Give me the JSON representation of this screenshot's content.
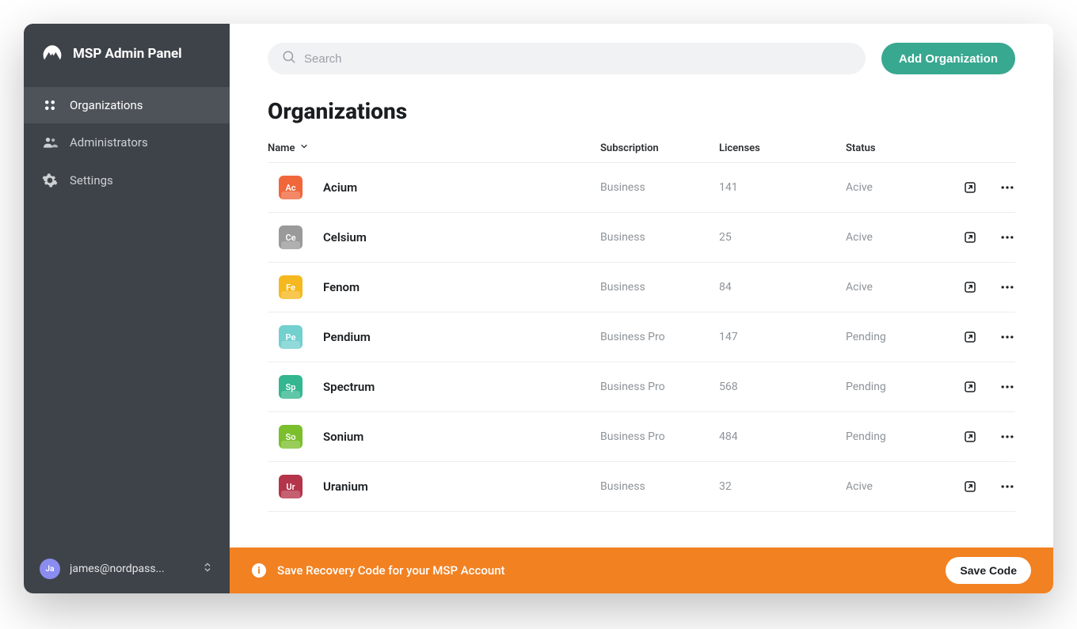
{
  "app_title": "MSP Admin Panel",
  "sidebar": {
    "items": [
      {
        "label": "Organizations"
      },
      {
        "label": "Administrators"
      },
      {
        "label": "Settings"
      }
    ]
  },
  "user": {
    "initials": "Ja",
    "email": "james@nordpass..."
  },
  "search": {
    "placeholder": "Search"
  },
  "add_button": "Add Organization",
  "page_title": "Organizations",
  "columns": {
    "name": "Name",
    "subscription": "Subscription",
    "licenses": "Licenses",
    "status": "Status"
  },
  "rows": [
    {
      "code": "Ac",
      "color": "#f0673b",
      "name": "Acium",
      "subscription": "Business",
      "licenses": "141",
      "status": "Acive"
    },
    {
      "code": "Ce",
      "color": "#9a9a9a",
      "name": "Celsium",
      "subscription": "Business",
      "licenses": "25",
      "status": "Acive"
    },
    {
      "code": "Fe",
      "color": "#f5b81e",
      "name": "Fenom",
      "subscription": "Business",
      "licenses": "84",
      "status": "Acive"
    },
    {
      "code": "Pe",
      "color": "#72d0cf",
      "name": "Pendium",
      "subscription": "Business Pro",
      "licenses": "147",
      "status": "Pending"
    },
    {
      "code": "Sp",
      "color": "#34b690",
      "name": "Spectrum",
      "subscription": "Business Pro",
      "licenses": "568",
      "status": "Pending"
    },
    {
      "code": "So",
      "color": "#7bbf2d",
      "name": "Sonium",
      "subscription": "Business Pro",
      "licenses": "484",
      "status": "Pending"
    },
    {
      "code": "Ur",
      "color": "#b4344a",
      "name": "Uranium",
      "subscription": "Business",
      "licenses": "32",
      "status": "Acive"
    }
  ],
  "banner": {
    "text": "Save Recovery Code for your MSP Account",
    "button": "Save Code"
  }
}
